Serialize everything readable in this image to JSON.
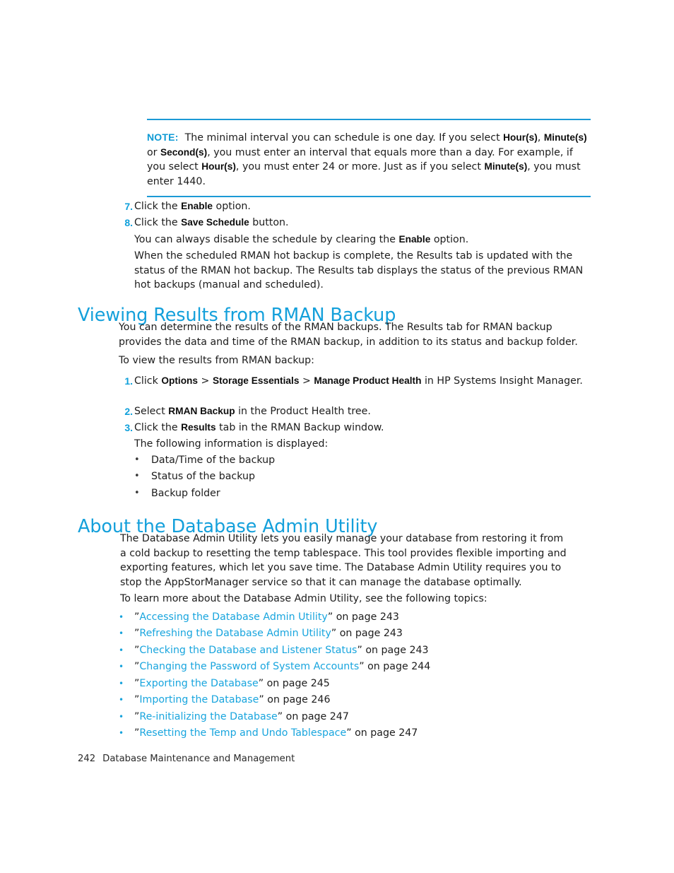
{
  "note": {
    "label": "NOTE:",
    "text_parts": [
      {
        "t": "The minimal interval you can schedule is one day. If you select ",
        "b": false
      },
      {
        "t": "Hour(s)",
        "b": true
      },
      {
        "t": ", ",
        "b": false
      },
      {
        "t": "Minute(s)",
        "b": true
      },
      {
        "t": " or ",
        "b": false
      },
      {
        "t": "Second(s)",
        "b": true
      },
      {
        "t": ", you must enter an interval that equals more than a day. For example, if you select ",
        "b": false
      },
      {
        "t": "Hour(s)",
        "b": true
      },
      {
        "t": ", you must enter 24 or more. Just as if you select ",
        "b": false
      },
      {
        "t": "Minute(s)",
        "b": true
      },
      {
        "t": ", you must enter 1440.",
        "b": false
      }
    ]
  },
  "steps_schedule": [
    {
      "number": "7.",
      "parts": [
        {
          "t": "Click the ",
          "b": false
        },
        {
          "t": "Enable",
          "b": true
        },
        {
          "t": " option.",
          "b": false
        }
      ]
    },
    {
      "number": "8.",
      "parts": [
        {
          "t": "Click the ",
          "b": false
        },
        {
          "t": "Save Schedule",
          "b": true
        },
        {
          "t": " button.",
          "b": false
        }
      ]
    }
  ],
  "step8_continuation": [
    {
      "parts": [
        {
          "t": "You can always disable the schedule by clearing the ",
          "b": false
        },
        {
          "t": "Enable",
          "b": true
        },
        {
          "t": " option.",
          "b": false
        }
      ]
    },
    {
      "parts": [
        {
          "t": "When the scheduled RMAN hot backup is complete, the Results tab is updated with the status of the RMAN hot backup. The Results tab displays the status of the previous RMAN hot backups (manual and scheduled).",
          "b": false
        }
      ]
    }
  ],
  "section_viewing_results": {
    "heading": "Viewing Results from RMAN Backup",
    "paragraph_1": "You can determine the results of the RMAN backups. The Results tab for RMAN backup provides the data and time of the RMAN backup, in addition to its status and backup folder.",
    "paragraph_2": "To view the results from RMAN backup:",
    "steps": [
      {
        "number": "1.",
        "parts": [
          {
            "t": "Click ",
            "b": false
          },
          {
            "t": "Options",
            "b": true
          },
          {
            "t": " > ",
            "b": false
          },
          {
            "t": "Storage Essentials",
            "b": true
          },
          {
            "t": " > ",
            "b": false
          },
          {
            "t": "Manage Product Health",
            "b": true
          },
          {
            "t": " in HP Systems Insight Manager.",
            "b": false
          }
        ]
      },
      {
        "number": "2.",
        "parts": [
          {
            "t": "Select ",
            "b": false
          },
          {
            "t": "RMAN Backup",
            "b": true
          },
          {
            "t": " in the Product Health tree.",
            "b": false
          }
        ]
      },
      {
        "number": "3.",
        "parts": [
          {
            "t": "Click the ",
            "b": false
          },
          {
            "t": "Results",
            "b": true
          },
          {
            "t": " tab in the RMAN Backup window.",
            "b": false
          }
        ]
      }
    ],
    "displayed_intro": "The following information is displayed:",
    "displayed_items": [
      "Data/Time of the backup",
      "Status of the backup",
      "Backup folder"
    ]
  },
  "section_about_utility": {
    "heading": "About the Database Admin Utility",
    "paragraph_1": "The Database Admin Utility lets you easily manage your database from restoring it from a cold backup to resetting the temp tablespace. This tool provides flexible importing and exporting features, which let you save time. The Database Admin Utility requires you to stop the AppStorManager service so that it can manage the database optimally.",
    "paragraph_2": "To learn more about the Database Admin Utility, see the following topics:",
    "topic_links": [
      {
        "title": "Accessing the Database Admin Utility",
        "suffix": " on page 243"
      },
      {
        "title": "Refreshing the Database Admin Utility",
        "suffix": " on page 243"
      },
      {
        "title": "Checking the Database and Listener Status",
        "suffix": " on page 243"
      },
      {
        "title": "Changing the Password of System Accounts",
        "suffix": " on page 244"
      },
      {
        "title": "Exporting the Database",
        "suffix": " on page 245"
      },
      {
        "title": "Importing the Database",
        "suffix": " on page 246"
      },
      {
        "title": "Re-initializing the Database",
        "suffix": " on page 247"
      },
      {
        "title": "Resetting the Temp and Undo Tablespace",
        "suffix": " on page 247"
      }
    ]
  },
  "footer": {
    "page_number": "242",
    "chapter_title": "Database Maintenance and Management"
  },
  "colors": {
    "accent": "#14a0db",
    "link": "#18a5de",
    "rule": "#1b9ad6",
    "text": "#1c1c1c"
  },
  "bullet_glyph": "•"
}
